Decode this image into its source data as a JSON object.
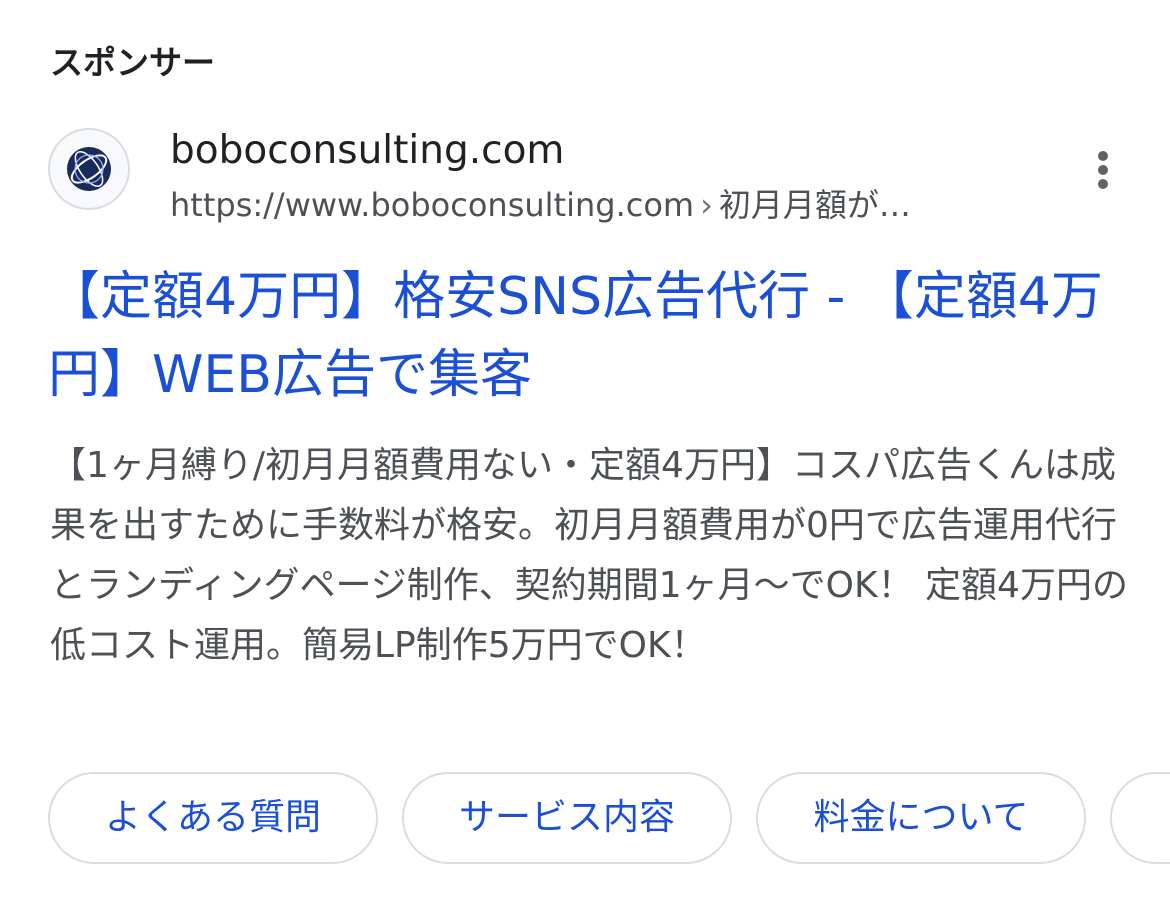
{
  "ad": {
    "sponsored_label": "スポンサー",
    "site_name": "boboconsulting.com",
    "url": "https://www.boboconsulting.com",
    "url_separator": "›",
    "breadcrumb": "初月月額が…",
    "favicon": "globe-logo-icon",
    "menu_icon": "more-vert-icon",
    "headline": "【定額4万円】格安SNS広告代行 - 【定額4万円】WEB広告で集客",
    "description": "【1ヶ月縛り/初月月額費用ない・定額4万円】コスパ広告くんは成果を出すために手数料が格安。初月月額費用が0円で広告運用代行とランディングページ制作、契約期間1ヶ月〜でOK！ 定額4万円の低コスト運用。簡易LP制作5万円でOK！",
    "sitelinks": [
      {
        "label": "よくある質問"
      },
      {
        "label": "サービス内容"
      },
      {
        "label": "料金について"
      },
      {
        "label": ""
      }
    ]
  },
  "colors": {
    "link_blue": "#1a4fd6",
    "text_primary": "#202124",
    "text_secondary": "#4d5156",
    "chip_border": "#dadce0"
  }
}
